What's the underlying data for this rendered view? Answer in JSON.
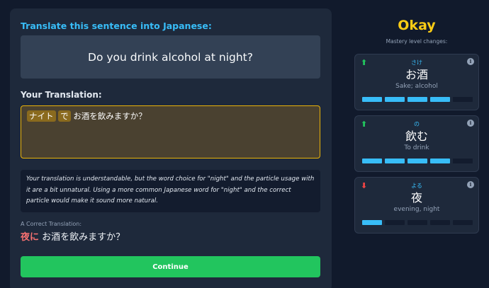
{
  "prompt": {
    "title": "Translate this sentence into Japanese:",
    "sentence": "Do you drink alcohol at night?"
  },
  "translation": {
    "label": "Your Translation:",
    "highlight_1": "ナイト",
    "highlight_2": "で",
    "rest": "お酒を飲みますか？"
  },
  "feedback": {
    "text": "Your translation is understandable, but the word choice for \"night\" and the particle usage with it are a bit unnatural. Using a more common Japanese word for \"night\" and the correct particle would make it sound more natural."
  },
  "correct": {
    "label": "A Correct Translation:",
    "highlight": "夜に",
    "rest": "お酒を飲みますか？"
  },
  "continue_label": "Continue",
  "result": {
    "title": "Okay",
    "mastery_label": "Mastery level changes:"
  },
  "cards": [
    {
      "direction": "up",
      "arrow": "⬆",
      "furigana": "さけ",
      "kanji": "お酒",
      "meaning": "Sake; alcohol",
      "level": 4,
      "max": 5
    },
    {
      "direction": "up",
      "arrow": "⬆",
      "furigana": "の",
      "kanji": "飲む",
      "meaning": "To drink",
      "level": 4,
      "max": 5
    },
    {
      "direction": "down",
      "arrow": "⬇",
      "furigana": "よる",
      "kanji": "夜",
      "meaning": "evening, night",
      "level": 1,
      "max": 5
    }
  ],
  "icons": {
    "info": "i"
  },
  "colors": {
    "accent": "#38bdf8",
    "result": "#facc15",
    "continue": "#22c55e",
    "up": "#22c55e",
    "down": "#ef4444",
    "correct_highlight": "#f87171"
  }
}
